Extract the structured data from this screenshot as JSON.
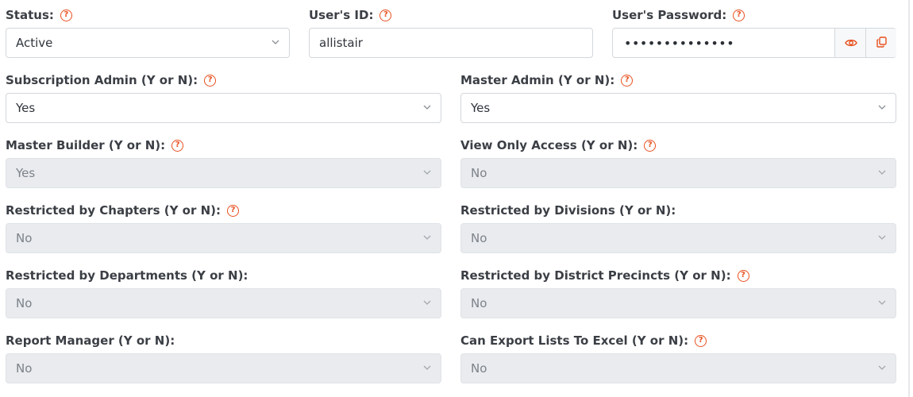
{
  "fields": {
    "status": {
      "label": "Status:",
      "value": "Active"
    },
    "user_id": {
      "label": "User's ID:",
      "value": "allistair"
    },
    "user_password": {
      "label": "User's Password:",
      "value": "••••••••••••••"
    },
    "subscription_admin": {
      "label": "Subscription Admin (Y or N):",
      "value": "Yes"
    },
    "master_admin": {
      "label": "Master Admin (Y or N):",
      "value": "Yes"
    },
    "master_builder": {
      "label": "Master Builder (Y or N):",
      "value": "Yes"
    },
    "view_only_access": {
      "label": "View Only Access (Y or N):",
      "value": "No"
    },
    "restricted_chapters": {
      "label": "Restricted by Chapters (Y or N):",
      "value": "No"
    },
    "restricted_divisions": {
      "label": "Restricted by Divisions (Y or N):",
      "value": "No"
    },
    "restricted_departments": {
      "label": "Restricted by Departments (Y or N):",
      "value": "No"
    },
    "restricted_district_precincts": {
      "label": "Restricted by District Precincts (Y or N):",
      "value": "No"
    },
    "report_manager": {
      "label": "Report Manager (Y or N):",
      "value": "No"
    },
    "export_excel": {
      "label": "Can Export Lists To Excel (Y or N):",
      "value": "No"
    }
  },
  "help_icon_glyph": "?",
  "colors": {
    "help_icon": "#e8501f",
    "disabled_bg": "#e9ebee",
    "border": "#d3d7dc"
  }
}
